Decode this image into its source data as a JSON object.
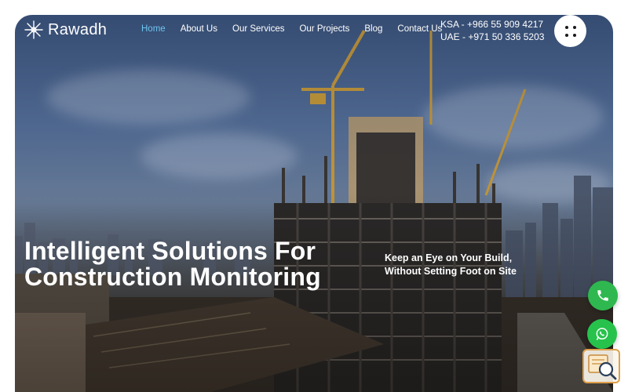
{
  "brand": {
    "name": "Rawadh"
  },
  "nav": {
    "items": [
      {
        "label": "Home",
        "active": true
      },
      {
        "label": "About Us",
        "active": false
      },
      {
        "label": "Our Services",
        "active": false
      },
      {
        "label": "Our Projects",
        "active": false
      },
      {
        "label": "Blog",
        "active": false
      },
      {
        "label": "Contact Us",
        "active": false
      }
    ]
  },
  "contact": {
    "ksa": "KSA - +966 55 909 4217",
    "uae": "UAE - +971 50 336 5203"
  },
  "hero": {
    "headline_line1": "Intelligent Solutions For",
    "headline_line2": "Construction Monitoring",
    "tagline_line1": "Keep an Eye on Your Build,",
    "tagline_line2": "Without Setting Foot on Site"
  },
  "icons": {
    "logo": "starburst-logo-icon",
    "menu": "grid-dots-icon",
    "phone": "phone-icon",
    "whatsapp": "whatsapp-icon",
    "badge": "search-document-icon"
  },
  "colors": {
    "accent": "#6cc3f0",
    "phone_button": "#2fb84f",
    "whatsapp_button": "#27c24c"
  }
}
